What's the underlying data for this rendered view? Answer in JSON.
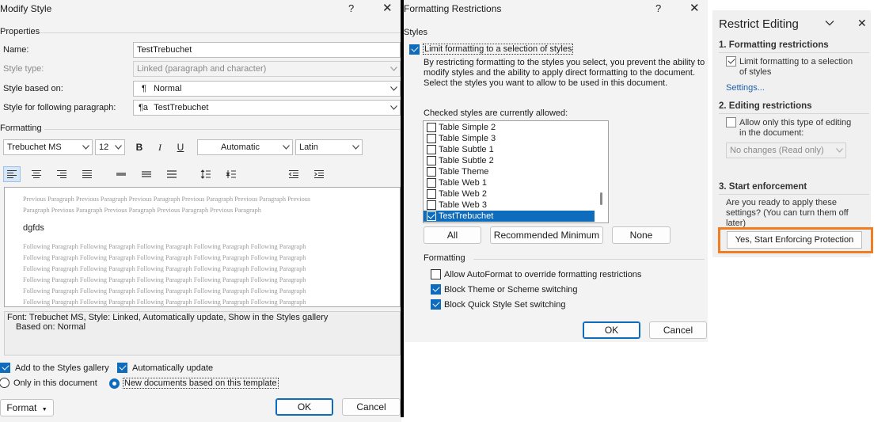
{
  "modify_style": {
    "title": "Modify Style",
    "properties_label": "Properties",
    "name_label": "Name:",
    "name_value": "TestTrebuchet",
    "style_type_label": "Style type:",
    "style_type_value": "Linked (paragraph and character)",
    "based_on_label": "Style based on:",
    "based_on_value": "Normal",
    "following_label": "Style for following paragraph:",
    "following_value": "TestTrebuchet",
    "formatting_label": "Formatting",
    "font_value": "Trebuchet MS",
    "size_value": "12",
    "bold_label": "B",
    "italic_label": "I",
    "underline_label": "U",
    "color_value": "Automatic",
    "script_value": "Latin",
    "preview_previous": [
      "Previous Paragraph Previous Paragraph Previous Paragraph Previous Paragraph Previous Paragraph Previous",
      "Paragraph Previous Paragraph Previous Paragraph Previous Paragraph Previous Paragraph"
    ],
    "preview_sample": "dgfds",
    "preview_following": [
      "Following Paragraph Following Paragraph Following Paragraph Following Paragraph Following Paragraph",
      "Following Paragraph Following Paragraph Following Paragraph Following Paragraph Following Paragraph",
      "Following Paragraph Following Paragraph Following Paragraph Following Paragraph Following Paragraph",
      "Following Paragraph Following Paragraph Following Paragraph Following Paragraph Following Paragraph",
      "Following Paragraph Following Paragraph Following Paragraph Following Paragraph Following Paragraph",
      "Following Paragraph Following Paragraph Following Paragraph Following Paragraph Following Paragraph"
    ],
    "description_line1": "Font: Trebuchet MS, Style: Linked, Automatically update, Show in the Styles gallery",
    "description_line2": "Based on: Normal",
    "add_to_gallery_label": "Add to the Styles gallery",
    "add_to_gallery_checked": true,
    "auto_update_label": "Automatically update",
    "auto_update_checked": true,
    "only_this_doc_label": "Only in this document",
    "new_docs_label": "New documents based on this template",
    "selected_scope": "new_docs",
    "format_button": "Format",
    "ok_button": "OK",
    "cancel_button": "Cancel"
  },
  "formatting_restrictions": {
    "title": "Formatting Restrictions",
    "styles_label": "Styles",
    "limit_label": "Limit formatting to a selection of styles",
    "limit_checked": true,
    "explanation": "By restricting formatting to the styles you select, you prevent the ability to modify styles and the ability to apply direct formatting to the document. Select the styles you want to allow to be used in this document.",
    "checked_label": "Checked styles are currently allowed:",
    "styles": [
      {
        "name": "Table Simple 2",
        "checked": false,
        "selected": false
      },
      {
        "name": "Table Simple 3",
        "checked": false,
        "selected": false
      },
      {
        "name": "Table Subtle 1",
        "checked": false,
        "selected": false
      },
      {
        "name": "Table Subtle 2",
        "checked": false,
        "selected": false
      },
      {
        "name": "Table Theme",
        "checked": false,
        "selected": false
      },
      {
        "name": "Table Web 1",
        "checked": false,
        "selected": false
      },
      {
        "name": "Table Web 2",
        "checked": false,
        "selected": false
      },
      {
        "name": "Table Web 3",
        "checked": false,
        "selected": false
      },
      {
        "name": "TestTrebuchet",
        "checked": true,
        "selected": true
      }
    ],
    "all_button": "All",
    "recommended_button": "Recommended Minimum",
    "none_button": "None",
    "formatting_label": "Formatting",
    "autoformat_label": "Allow AutoFormat to override formatting restrictions",
    "autoformat_checked": false,
    "block_theme_label": "Block Theme or Scheme switching",
    "block_theme_checked": true,
    "block_quickstyle_label": "Block Quick Style Set switching",
    "block_quickstyle_checked": true,
    "ok_button": "OK",
    "cancel_button": "Cancel"
  },
  "restrict_editing": {
    "title": "Restrict Editing",
    "section1_title": "1. Formatting restrictions",
    "limit_label_line1": "Limit formatting to a selection",
    "limit_label_line2": "of styles",
    "limit_checked": true,
    "settings_link": "Settings...",
    "section2_title": "2. Editing restrictions",
    "allow_label_line1": "Allow only this type of editing",
    "allow_label_line2": "in the document:",
    "allow_checked": false,
    "editing_type_value": "No changes (Read only)",
    "section3_title": "3. Start enforcement",
    "ready_line1": "Are you ready to apply these",
    "ready_line2": "settings? (You can turn them off",
    "ready_line3": "later)",
    "enforce_button": "Yes, Start Enforcing Protection",
    "highlight_color": "#f07d22"
  }
}
